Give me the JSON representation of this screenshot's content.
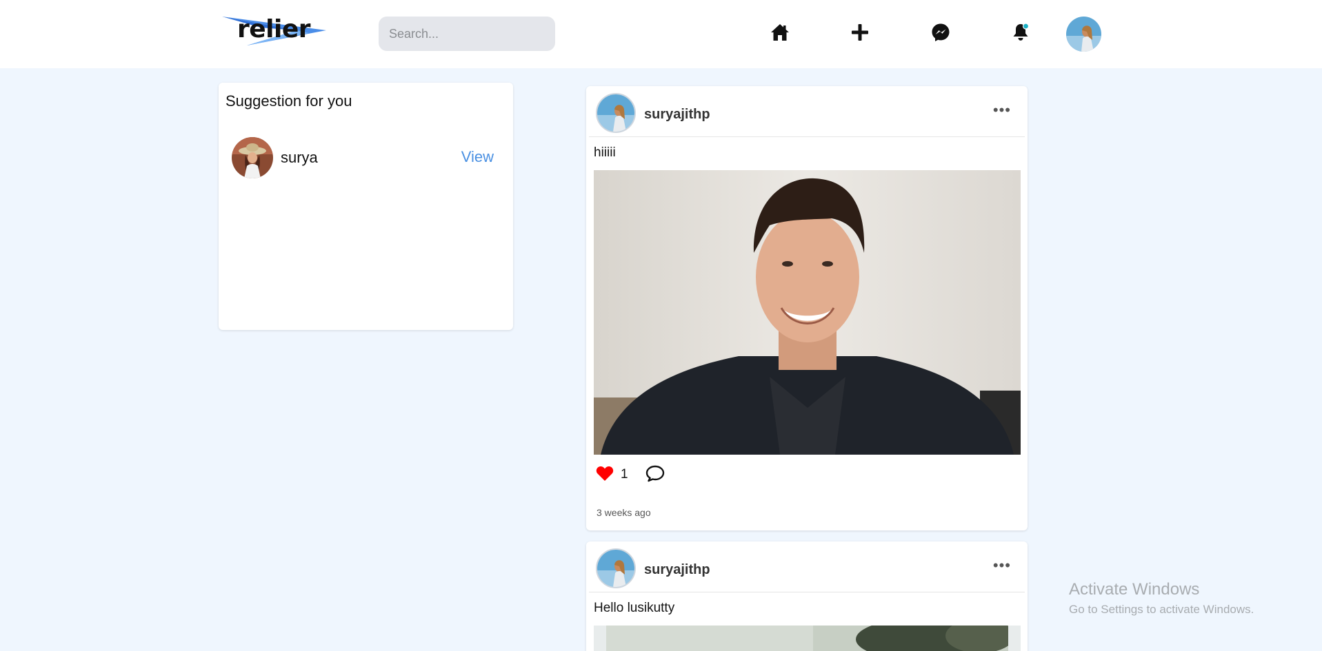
{
  "header": {
    "logo_text": "relier",
    "search": {
      "placeholder": "Search...",
      "value": ""
    },
    "nav_icons": [
      "home-icon",
      "plus-icon",
      "messenger-icon",
      "bell-icon"
    ],
    "notification_dot_color": "#1bb0c4"
  },
  "suggestions": {
    "title": "Suggestion for you",
    "items": [
      {
        "name": "surya",
        "action": "View"
      }
    ]
  },
  "posts": [
    {
      "username": "suryajithp",
      "caption": "hiiiii",
      "likes": "1",
      "liked": true,
      "time": "3 weeks ago"
    },
    {
      "username": "suryajithp",
      "caption": "Hello lusikutty"
    }
  ],
  "watermark": {
    "title": "Activate Windows",
    "subtitle": "Go to Settings to activate Windows."
  },
  "colors": {
    "background": "#eff6fe",
    "accent": "#4a90e2",
    "like": "#ff0000"
  }
}
